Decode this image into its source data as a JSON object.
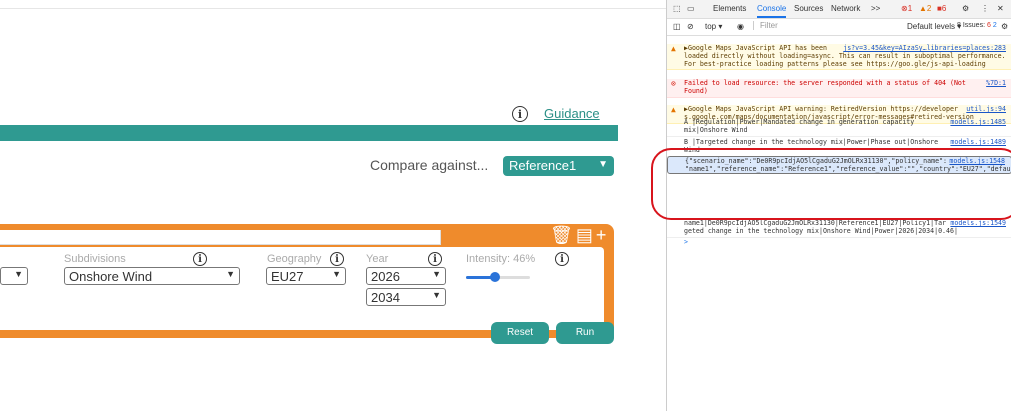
{
  "page": {
    "guidance_label": "Guidance",
    "info_glyph": "i",
    "compare_label": "Compare against...",
    "compare_value": "Reference1",
    "name_input_value": "",
    "subdivisions_label": "Subdivisions",
    "subdivisions_value": "Onshore Wind",
    "geography_label": "Geography",
    "geography_value": "EU27",
    "year_label": "Year",
    "year_start": "2026",
    "year_end": "2034",
    "intensity_label": "Intensity: 46%",
    "intensity_value": 0.46,
    "reset_label": "Reset",
    "run_label": "Run",
    "accent_teal": "#2f9a91",
    "accent_orange": "#ef8b2c"
  },
  "devtools": {
    "tabs": [
      "Elements",
      "Console",
      "Sources",
      "Network",
      ">>"
    ],
    "active_tab": "Console",
    "error_count": "1",
    "warning_count": "2",
    "issue_count": "6",
    "context": "top",
    "filter_placeholder": "Filter",
    "default_levels": "Default levels",
    "issues_label": "8 Issues:",
    "issues_a": "6",
    "issues_b": "2",
    "logs": [
      {
        "type": "warn",
        "text": "▶Google Maps JavaScript API has been\nloaded directly without loading=async. This can result in suboptimal performance.\nFor best-practice loading patterns please see https://goo.gle/js-api-loading",
        "src": "js?v=3.45&key=AIzaSy…libraries=places:283"
      },
      {
        "type": "err",
        "text": "Failed to load resource: the server responded with a status of 404 (Not\nFound)",
        "src": "%7D:1"
      },
      {
        "type": "warn",
        "text": "▶Google Maps JavaScript API warning: RetiredVersion https://developer\ns.google.com/maps/documentation/javascript/error-messages#retired-version",
        "src": "util.js:94"
      },
      {
        "type": "info",
        "text": "A |Regulation|Power|Mandated change in generation capacity\nmix|Onshore Wind",
        "src": "models.js:1485"
      },
      {
        "type": "info",
        "text": "B |Targeted change in the technology mix|Power|Phase out|Onshore\nWind",
        "src": "models.js:1489"
      },
      {
        "type": "sel",
        "text": "{\"scenario_name\":\"De0R9pcIdjAO5lCgaduG2JmOLRx31130\",\"policy_name\":\n\"name1\",\"reference_name\":\"Reference1\",\"reference_value\":\"\",\"country\":\"EU27\",\"defau\nlt_start\":2020,\"default_end\":2050,\"policies\":\n[{\"policy_input\":\"Policy1\",\"policy_category\":\"Targeted change in the technology\nmix\",\"subdivision\":\"Onshore\nWind\",\"model\":\"Power\",\"start\":2026,\"end\":2034,\"intensity\":0.46}]}",
        "src": "models.js:1548"
      },
      {
        "type": "info",
        "text": "name1|De0R9pcIdjAO5lCgaduG2JmOLRx31130|Reference1|EU27|Policy1|Tar\ngeted change in the technology mix|Onshore Wind|Power|2026|2034|0.46|",
        "src": "models.js:1549"
      }
    ],
    "prompt": ">"
  }
}
